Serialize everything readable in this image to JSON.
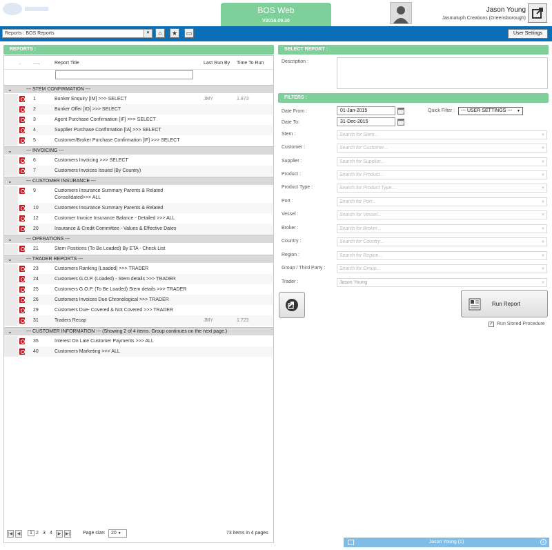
{
  "header": {
    "app_title": "BOS Web",
    "version": "V2016.09.30",
    "user_name": "Jason Young",
    "user_company": "Jasmatuph Creations (Greensborough)"
  },
  "toolbar": {
    "report_select_value": "Reports : BOS Reports",
    "user_settings_label": "User Settings"
  },
  "left": {
    "section_title": "REPORTS :",
    "columns": {
      "dots1": ".",
      "dots2": ".....",
      "title": "Report Title",
      "last_run": "Last Run By",
      "time": "Time To Run"
    }
  },
  "groups": [
    {
      "title": "--- STEM CONFIRMATION ---",
      "rows": [
        {
          "num": "1",
          "title": "Bunker Enquiry [IM] >>> SELECT",
          "last_run": "JMY",
          "time": "1.873"
        },
        {
          "num": "2",
          "title": "Bunker Offer [IO] >>> SELECT",
          "last_run": "",
          "time": ""
        },
        {
          "num": "3",
          "title": "Agent Purchase Confirmation [IF] >>> SELECT",
          "last_run": "",
          "time": ""
        },
        {
          "num": "4",
          "title": "Supplier Purchase Confirmation [IA] >>> SELECT",
          "last_run": "",
          "time": ""
        },
        {
          "num": "5",
          "title": "Customer/Broker Purchase Confirmation [IF] >>> SELECT",
          "last_run": "",
          "time": ""
        }
      ]
    },
    {
      "title": "--- INVOICING ---",
      "rows": [
        {
          "num": "6",
          "title": "Customers Invoicing >>> SELECT",
          "last_run": "",
          "time": ""
        },
        {
          "num": "7",
          "title": "Customers Invoices Issued (By Country)",
          "last_run": "",
          "time": ""
        }
      ]
    },
    {
      "title": "--- CUSTOMER INSURANCE ---",
      "rows": [
        {
          "num": "9",
          "title": "Customers Insurance Summary Parents & Related Consolidated>>> ALL",
          "last_run": "",
          "time": ""
        },
        {
          "num": "10",
          "title": "Customers Insurance Summary Parents & Related",
          "last_run": "",
          "time": ""
        },
        {
          "num": "12",
          "title": "Customer Invoice Insurance Balance - Detailed >>> ALL",
          "last_run": "",
          "time": ""
        },
        {
          "num": "20",
          "title": "Insurance & Credit Committee - Values & Effective Dates",
          "last_run": "",
          "time": ""
        }
      ]
    },
    {
      "title": "--- OPERATIONS ---",
      "rows": [
        {
          "num": "21",
          "title": "Stem Positions (To Be Loaded) By ETA - Check List",
          "last_run": "",
          "time": ""
        }
      ]
    },
    {
      "title": "--- TRADER REPORTS ---",
      "rows": [
        {
          "num": "23",
          "title": "Customers Ranking (Loaded) >>> TRADER",
          "last_run": "",
          "time": ""
        },
        {
          "num": "24",
          "title": "Customers G.O.P. (Loaded) - Stem details >>> TRADER",
          "last_run": "",
          "time": ""
        },
        {
          "num": "25",
          "title": "Customers G.O.P. (To Be Loaded) Stem details >>> TRADER",
          "last_run": "",
          "time": ""
        },
        {
          "num": "26",
          "title": "Customers Invoices Due Chronological >>> TRADER",
          "last_run": "",
          "time": ""
        },
        {
          "num": "29",
          "title": "Customers Due- Covered & Not Covered >>> TRADER",
          "last_run": "",
          "time": ""
        },
        {
          "num": "31",
          "title": "Traders Recap",
          "last_run": "JMY",
          "time": "1.723"
        }
      ]
    },
    {
      "title": "--- CUSTOMER INFORMATION --- (Showing 2 of 4 items. Group continues on the next page.)",
      "rows": [
        {
          "num": "35",
          "title": "Interest On Late Customer Payments >>> ALL",
          "last_run": "",
          "time": ""
        },
        {
          "num": "40",
          "title": "Customers Marketing >>> ALL",
          "last_run": "",
          "time": ""
        }
      ]
    }
  ],
  "pager": {
    "pages": [
      "1",
      "2",
      "3",
      "4"
    ],
    "page_size_label": "Page size:",
    "page_size": "20",
    "summary": "73 items in 4 pages"
  },
  "right": {
    "select_report_title": "SELECT REPORT :",
    "description_label": "Description :",
    "filters_title": "FILTERS :",
    "date_from_label": "Date From :",
    "date_from": "01-Jan-2015",
    "date_to_label": "Date To:",
    "date_to": "31-Dec-2015",
    "quick_filter_label": "Quick Filter :",
    "quick_filter_value": "--- USER SETTINGS ---",
    "filters": [
      {
        "label": "Stem :",
        "placeholder": "Search for Stem..."
      },
      {
        "label": "Customer :",
        "placeholder": "Search for Customer..."
      },
      {
        "label": "Supplier :",
        "placeholder": "Search for Supplier..."
      },
      {
        "label": "Product :",
        "placeholder": "Search for Product..."
      },
      {
        "label": "Product Type :",
        "placeholder": "Search for Product Type..."
      },
      {
        "label": "Port :",
        "placeholder": "Search for Port..."
      },
      {
        "label": "Vessel :",
        "placeholder": "Search for Vessel..."
      },
      {
        "label": "Broker :",
        "placeholder": "Search for Broker..."
      },
      {
        "label": "Country :",
        "placeholder": "Search for Country..."
      },
      {
        "label": "Region :",
        "placeholder": "Search for Region..."
      },
      {
        "label": "Group / Third Party :",
        "placeholder": "Search for Group..."
      }
    ],
    "trader_label": "Trader :",
    "trader_value": "Jason Young",
    "run_report_label": "Run Report",
    "run_stored_label": "Run Stored Procedure",
    "run_stored_checked": true
  },
  "chat": {
    "label": "Jason Young (1)"
  },
  "colors": {
    "accent_green": "#7fcf9a",
    "brand_blue": "#0a6fb7",
    "pdf_red": "#c8181e"
  }
}
